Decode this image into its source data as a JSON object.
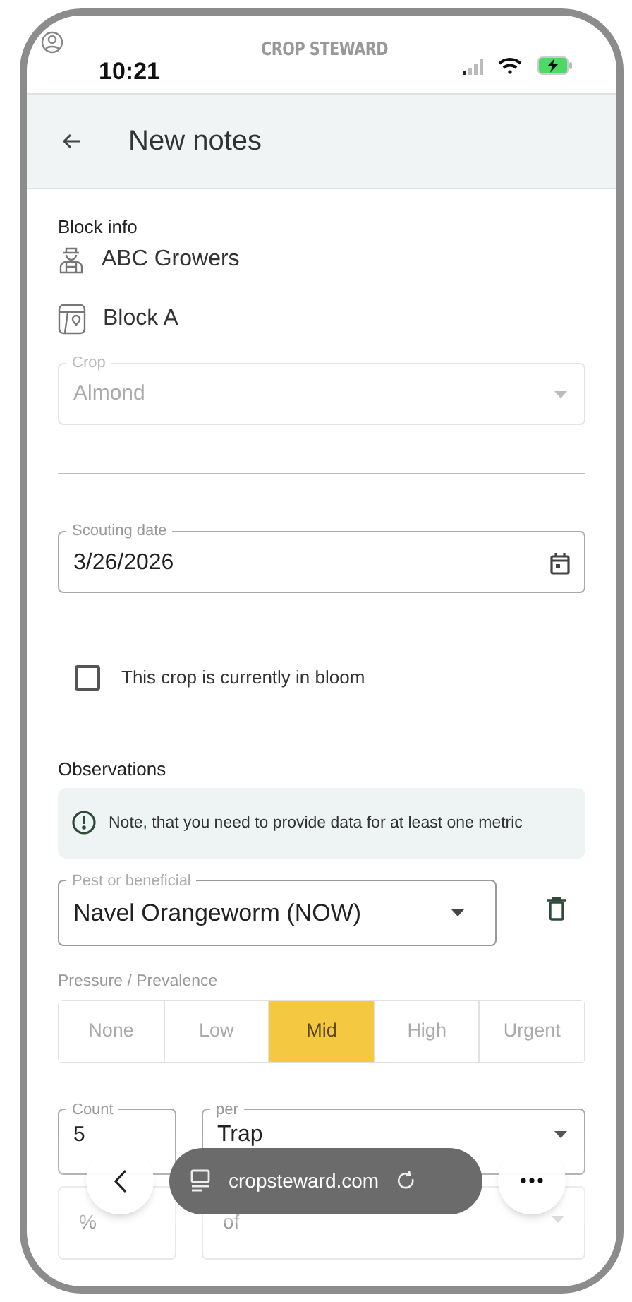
{
  "status_bar": {
    "time": "10:21",
    "app_name": "CROP STEWARD"
  },
  "header": {
    "title": "New notes"
  },
  "block_info": {
    "heading": "Block info",
    "grower": "ABC Growers",
    "block": "Block A"
  },
  "crop_field": {
    "label": "Crop",
    "value": "Almond",
    "disabled": true
  },
  "scouting_date": {
    "label": "Scouting date",
    "value": "3/26/2026"
  },
  "bloom_checkbox": {
    "label": "This crop is currently in bloom",
    "checked": false
  },
  "observations": {
    "heading": "Observations",
    "note": "Note, that you need to provide data for at least one metric",
    "pest_field": {
      "label": "Pest or beneficial",
      "value": "Navel Orangeworm (NOW)"
    },
    "pressure": {
      "label": "Pressure / Prevalence",
      "options": [
        {
          "label": "None",
          "selected": false
        },
        {
          "label": "Low",
          "selected": false
        },
        {
          "label": "Mid",
          "selected": true
        },
        {
          "label": "High",
          "selected": false
        },
        {
          "label": "Urgent",
          "selected": false
        }
      ]
    },
    "count_field": {
      "label": "Count",
      "value": "5"
    },
    "per_field": {
      "label": "per",
      "value": "Trap"
    },
    "percent_field": {
      "placeholder": "%"
    },
    "of_field": {
      "placeholder": "of"
    }
  },
  "browser_bar": {
    "url": "cropsteward.com"
  }
}
